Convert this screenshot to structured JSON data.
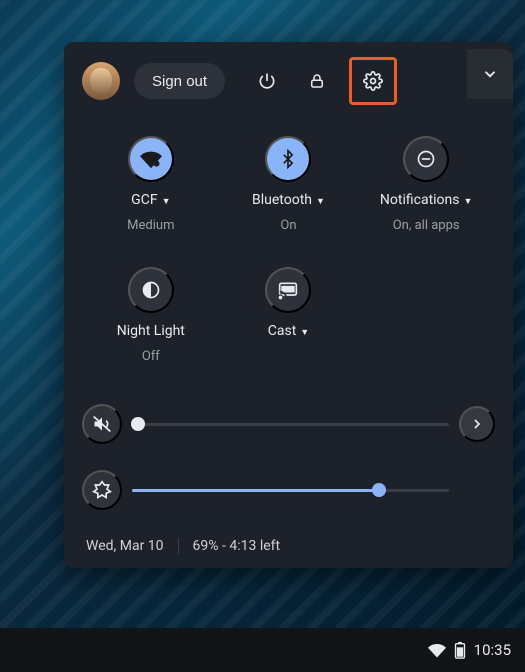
{
  "header": {
    "signout_label": "Sign out"
  },
  "tiles": {
    "wifi": {
      "label": "GCF",
      "sub": "Medium",
      "has_caret": true,
      "active": true
    },
    "bluetooth": {
      "label": "Bluetooth",
      "sub": "On",
      "has_caret": true,
      "active": true
    },
    "notifications": {
      "label": "Notifications",
      "sub": "On, all apps",
      "has_caret": true,
      "active": false
    },
    "nightlight": {
      "label": "Night Light",
      "sub": "Off",
      "has_caret": false,
      "active": false
    },
    "cast": {
      "label": "Cast",
      "sub": "",
      "has_caret": true,
      "active": false
    }
  },
  "sliders": {
    "volume": {
      "percent": 2
    },
    "brightness": {
      "percent": 78
    }
  },
  "footer": {
    "date": "Wed, Mar 10",
    "battery_text": "69% - 4:13 left"
  },
  "shelf": {
    "time": "10:35"
  }
}
